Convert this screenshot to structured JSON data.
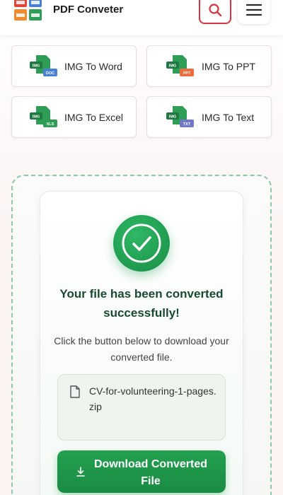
{
  "header": {
    "title": "PDF Conveter",
    "search_icon": "search-icon",
    "menu_icon": "hamburger-menu-icon"
  },
  "tools": [
    {
      "label": "IMG To Word",
      "badge": "DOC",
      "badge_color": "#4a7fd6"
    },
    {
      "label": "IMG To PPT",
      "badge": "PPT",
      "badge_color": "#ef6a3a"
    },
    {
      "label": "IMG To Excel",
      "badge": "XLS",
      "badge_color": "#2e9d56"
    },
    {
      "label": "IMG To Text",
      "badge": "TXT",
      "badge_color": "#6f78c9"
    }
  ],
  "result": {
    "title": "Your file has been converted successfully!",
    "description": "Click the button below to download your converted file.",
    "file_name": "CV-for-volunteering-1-pages.zip",
    "download_label": "Download Converted File"
  },
  "colors": {
    "accent_green": "#1f9a4f",
    "search_border": "#d9333f",
    "title_green": "#184a2f"
  }
}
